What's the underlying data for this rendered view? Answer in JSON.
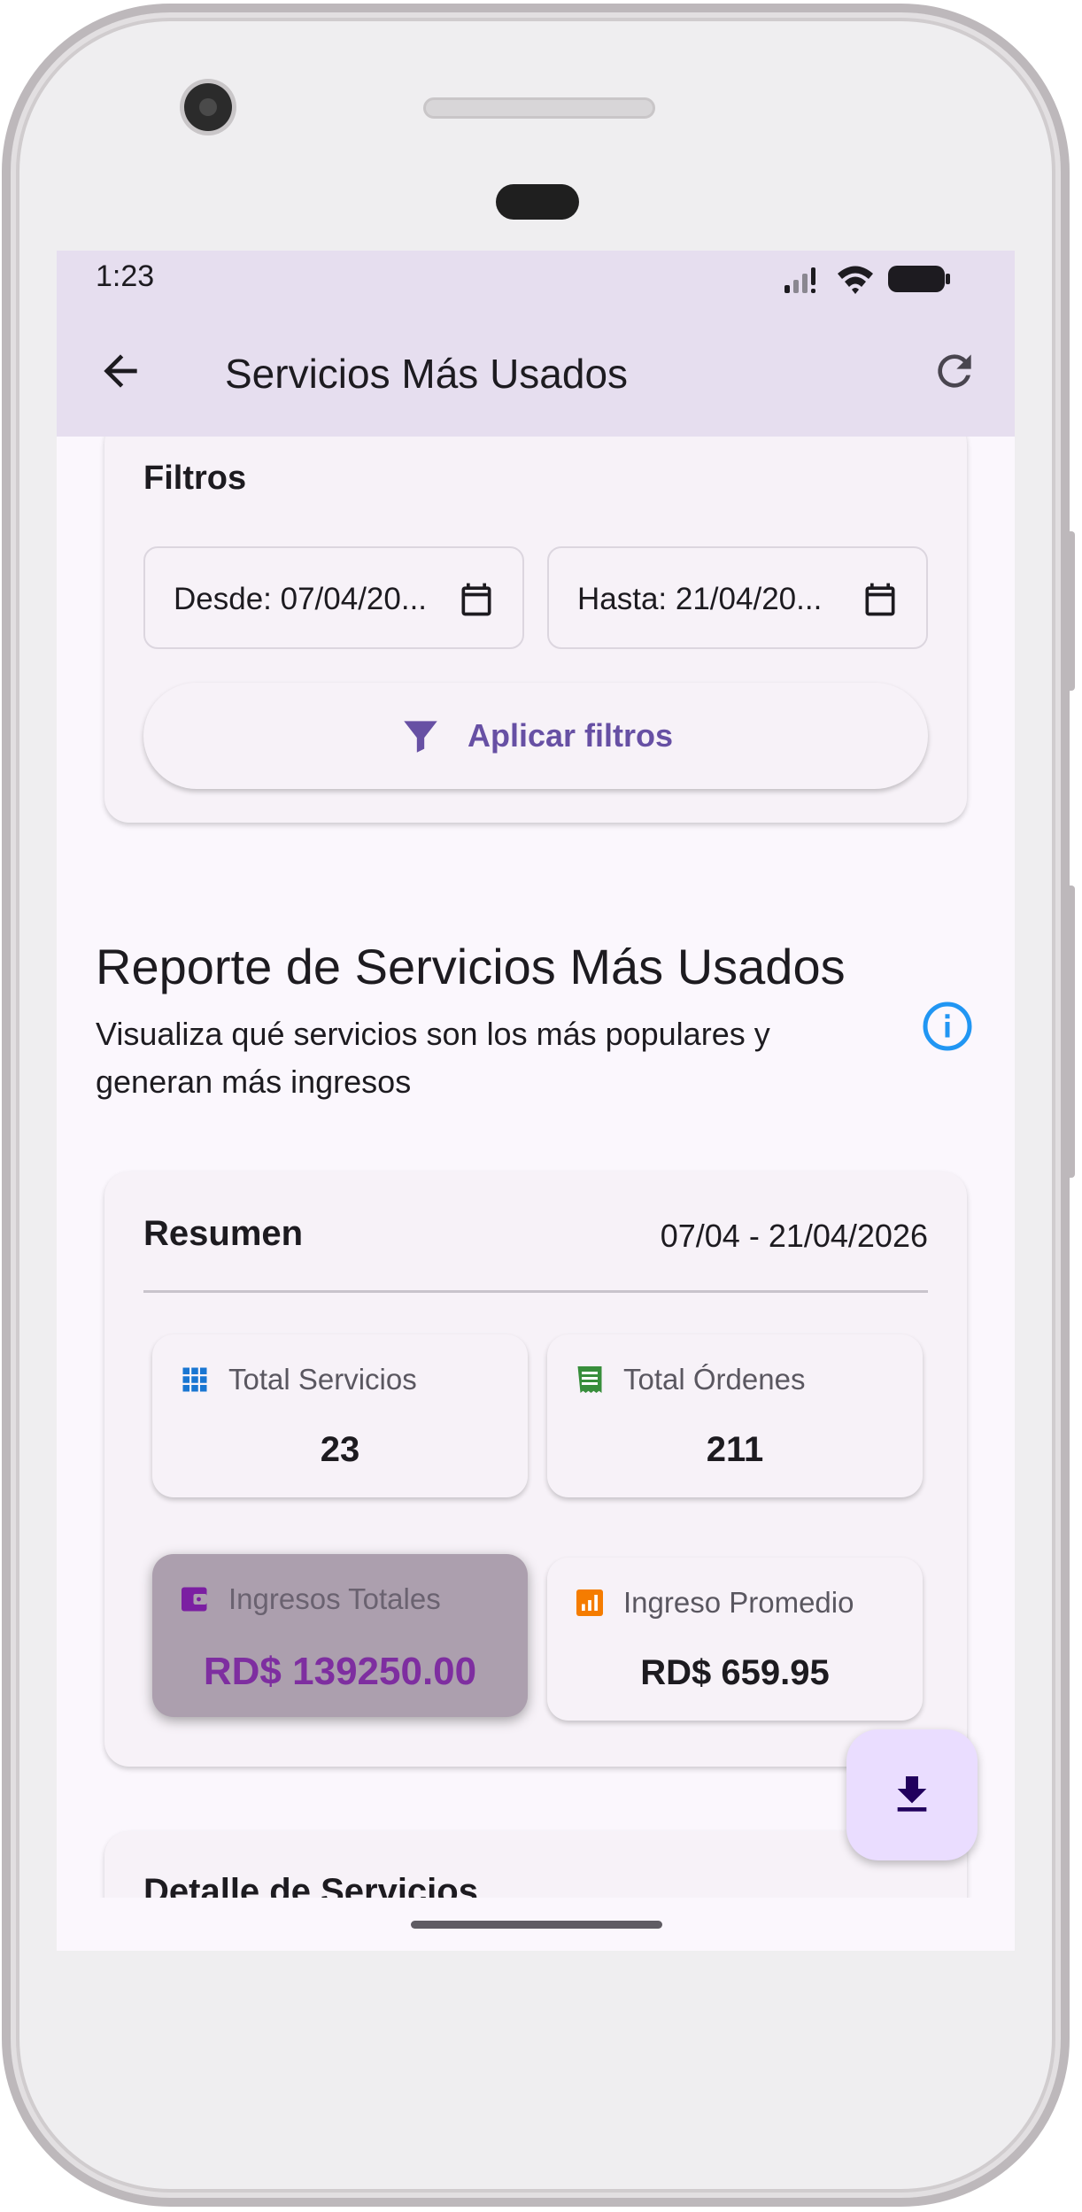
{
  "status_bar": {
    "time": "1:23"
  },
  "app_bar": {
    "title": "Servicios Más Usados"
  },
  "filters": {
    "title": "Filtros",
    "from_value": "Desde: 07/04/20...",
    "to_value": "Hasta: 21/04/20...",
    "apply_label": "Aplicar filtros"
  },
  "report": {
    "title": "Reporte de Servicios Más Usados",
    "subtitle": "Visualiza qué servicios son los más populares y generan más ingresos"
  },
  "summary": {
    "title": "Resumen",
    "date_range": "07/04 - 21/04/2026",
    "stats": [
      {
        "label": "Total Servicios",
        "value": "23",
        "icon": "grid-icon",
        "color": "#1976d2"
      },
      {
        "label": "Total Órdenes",
        "value": "211",
        "icon": "receipt-icon",
        "color": "#388e3c"
      },
      {
        "label": "Ingresos Totales",
        "value": "RD$ 139250.00",
        "icon": "wallet-icon",
        "color": "#7b1fa2"
      },
      {
        "label": "Ingreso Promedio",
        "value": "RD$ 659.95",
        "icon": "bar-chart-icon",
        "color": "#f57c00"
      }
    ]
  },
  "detail": {
    "title": "Detalle de Servicios"
  },
  "colors": {
    "primary": "#6750a4",
    "app_bar_bg": "#e6deef",
    "screen_bg": "#fbf7fd",
    "info": "#2196f3",
    "fab_bg": "#eaddff"
  }
}
